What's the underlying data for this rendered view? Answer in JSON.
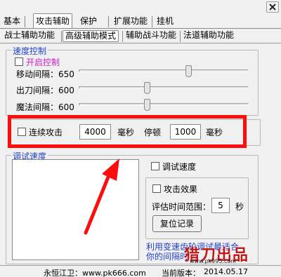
{
  "tabs": [
    "基本",
    "攻击辅助",
    "保护",
    "扩展功能",
    "挂机"
  ],
  "subtabs": [
    "战士辅助功能",
    "高级辅助模式",
    "辅助战斗功能",
    "法道辅助功能"
  ],
  "speed_group": {
    "title": "速度控制",
    "enable_label": "开启控制",
    "sliders": [
      {
        "label": "移动间隔：650",
        "value": 650
      },
      {
        "label": "出刀间隔：600",
        "value": 600
      },
      {
        "label": "魔法间隔：600",
        "value": 600
      }
    ]
  },
  "combo": {
    "checkbox_label": "连续攻击",
    "attack_value": "4000",
    "unit1": "毫秒",
    "pause_label": "停顿",
    "pause_value": "1000",
    "unit2": "毫秒"
  },
  "debug_group": {
    "title": "调试速度",
    "debug_speed_label": "调试速度",
    "attack_effect_label": "攻击效果",
    "eval_range_label": "评估时间范围：",
    "eval_range_value": "5",
    "eval_unit": "秒",
    "reset_button": "复位记录",
    "hint_line1": "利用变速齿轮调试最适合",
    "hint_line2": "你的间隔时间"
  },
  "status_bar": {
    "left": "永恒江卫：www.pk666.com",
    "right_label": "当前版本：",
    "version": "2014.05.17"
  },
  "watermark": {
    "text": "猎刀出品",
    "url": "www.pk995.com"
  },
  "colors": {
    "title_blue": "#2244cc",
    "enable_label": "#cc22cc",
    "annotation_red": "#ff0d0d"
  }
}
